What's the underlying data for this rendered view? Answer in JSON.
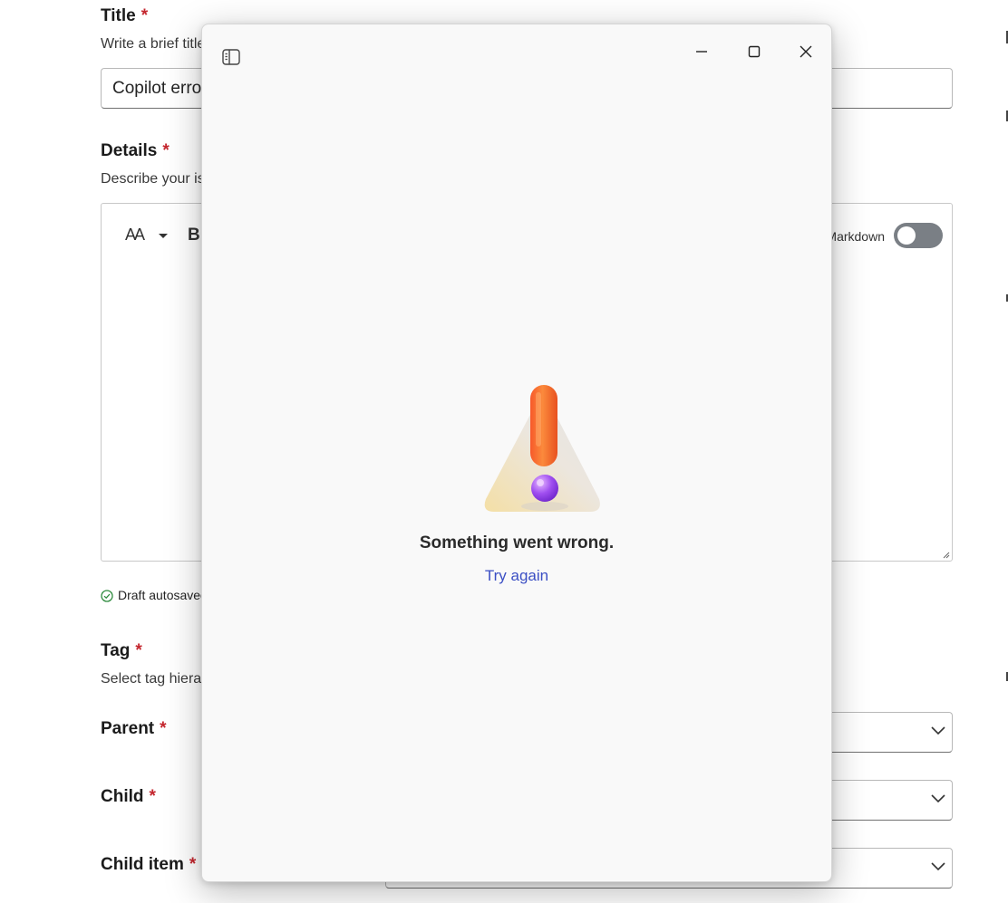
{
  "form": {
    "title": {
      "label": "Title",
      "required": "*",
      "hint": "Write a brief title",
      "value": "Copilot error"
    },
    "details": {
      "label": "Details",
      "required": "*",
      "hint": "Describe your issue"
    },
    "editor": {
      "font_size_glyph": "AA",
      "bold_glyph": "B",
      "markdown_label": "Markdown",
      "markdown_enabled": false
    },
    "autosave": {
      "text": "Draft autosaved"
    },
    "tag": {
      "label": "Tag",
      "required": "*",
      "hint": "Select tag hierarchy"
    },
    "parent": {
      "label": "Parent",
      "required": "*",
      "value": ""
    },
    "child": {
      "label": "Child",
      "required": "*",
      "value": ""
    },
    "child_item": {
      "label": "Child item",
      "required": "*",
      "value": ""
    }
  },
  "copilot": {
    "error_message": "Something went wrong.",
    "retry_label": "Try again",
    "icons": [
      "sidebar-toggle-icon",
      "minimize-icon",
      "maximize-icon",
      "close-icon",
      "warning-illustration"
    ]
  },
  "colors": {
    "required": "#c4262e",
    "link": "#3b4fc4",
    "window_bg": "#f9f9f9",
    "success": "#2e8b3e"
  }
}
